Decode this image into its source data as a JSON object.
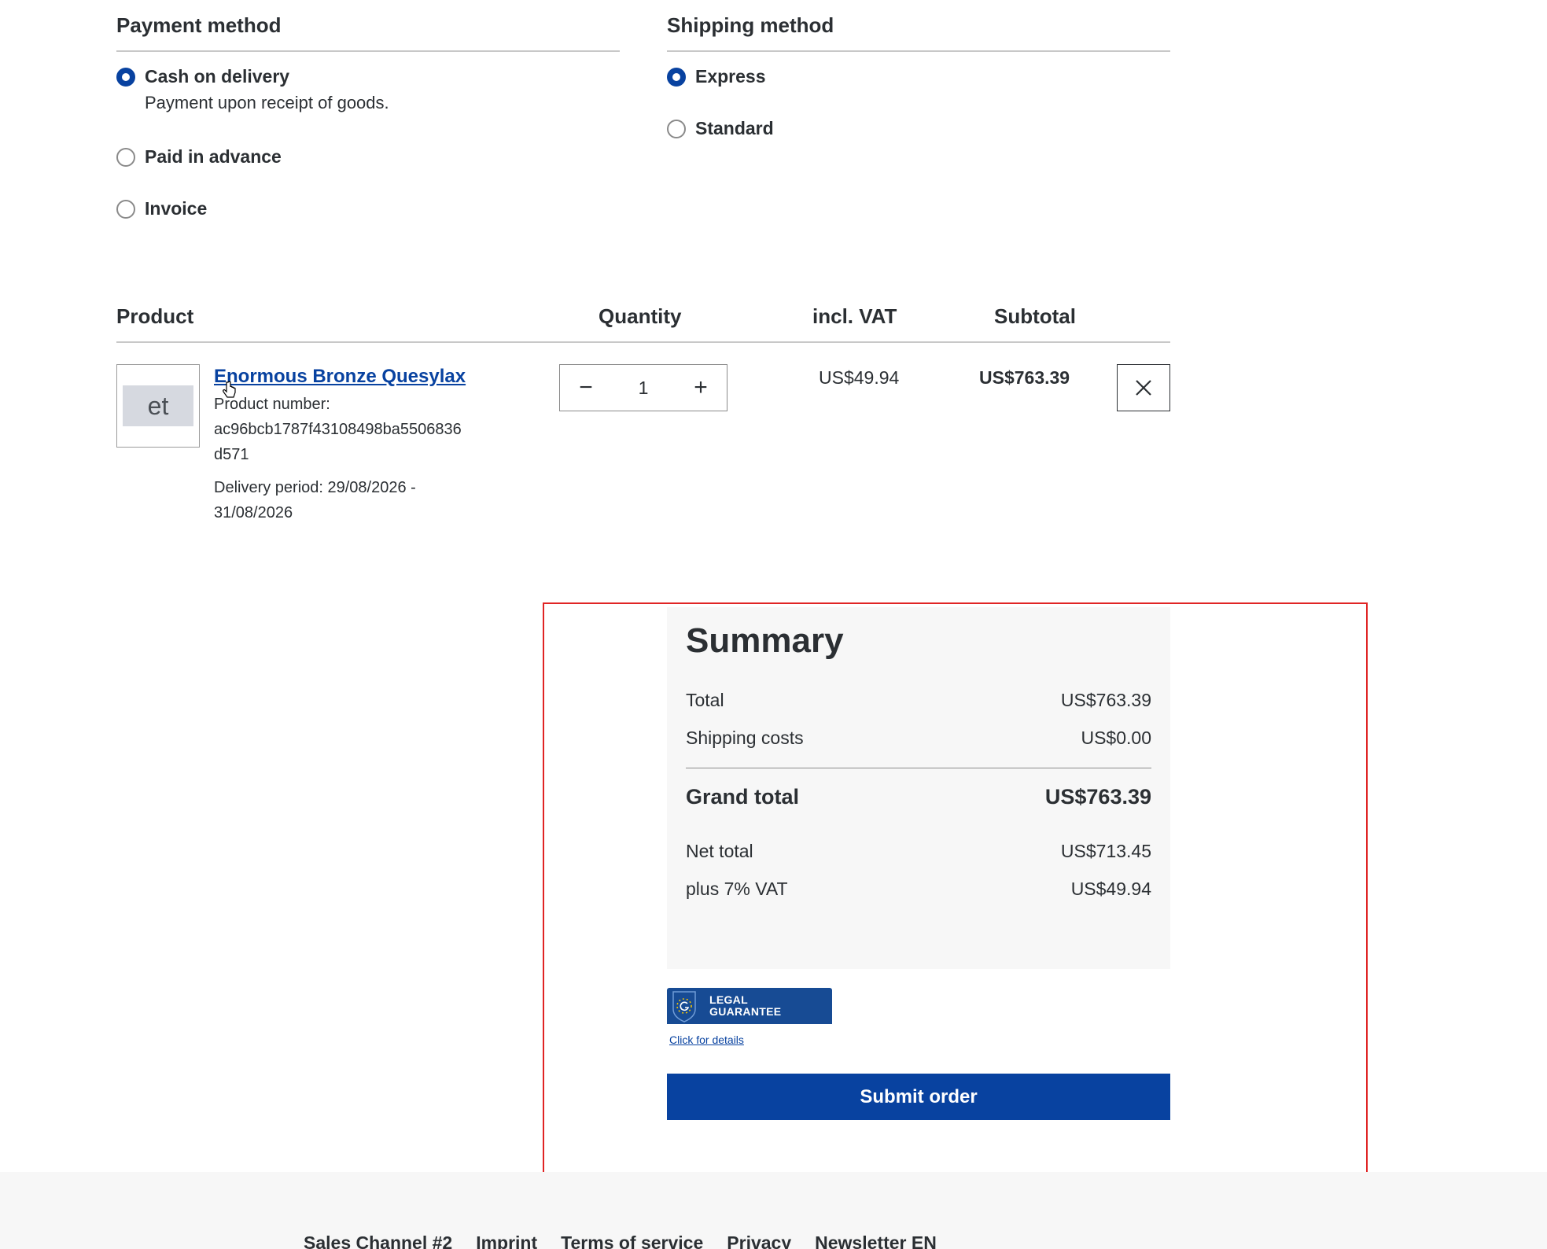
{
  "payment": {
    "title": "Payment method",
    "options": [
      {
        "label": "Cash on delivery",
        "description": "Payment upon receipt of goods.",
        "checked": true
      },
      {
        "label": "Paid in advance",
        "checked": false
      },
      {
        "label": "Invoice",
        "checked": false
      }
    ]
  },
  "shipping": {
    "title": "Shipping method",
    "options": [
      {
        "label": "Express",
        "checked": true
      },
      {
        "label": "Standard",
        "checked": false
      }
    ]
  },
  "cart": {
    "headers": {
      "product": "Product",
      "quantity": "Quantity",
      "vat": "incl. VAT",
      "subtotal": "Subtotal"
    },
    "item": {
      "thumb_text": "et",
      "name": "Enormous Bronze Quesylax",
      "number_label": "Product number:",
      "number_line1": "ac96bcb1787f43108498ba5506836",
      "number_line2": "d571",
      "delivery_line1": "Delivery period: 29/08/2026 -",
      "delivery_line2": "31/08/2026",
      "quantity": "1",
      "vat": "US$49.94",
      "subtotal": "US$763.39"
    }
  },
  "summary": {
    "title": "Summary",
    "total_label": "Total",
    "total_value": "US$763.39",
    "shipping_label": "Shipping costs",
    "shipping_value": "US$0.00",
    "grand_label": "Grand total",
    "grand_value": "US$763.39",
    "net_label": "Net total",
    "net_value": "US$713.45",
    "vat_label": "plus 7% VAT",
    "vat_value": "US$49.94"
  },
  "badge": {
    "line1": "LEGAL",
    "line2": "GUARANTEE",
    "link": "Click for details"
  },
  "submit_label": "Submit order",
  "footer": {
    "links": [
      "Sales Channel #2",
      "Imprint",
      "Terms of service",
      "Privacy",
      "Newsletter EN"
    ]
  },
  "colors": {
    "accent": "#0842a0",
    "highlight": "#e02424",
    "panel": "#f7f7f7"
  }
}
